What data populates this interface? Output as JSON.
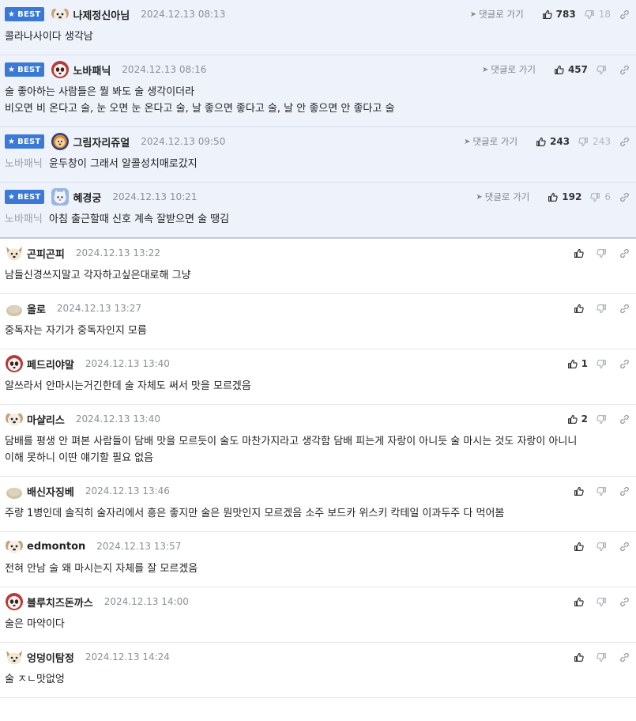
{
  "ui": {
    "best_label": "BEST",
    "goto_label": "댓글로 가기"
  },
  "colors": {
    "best_bg": "#eef3fb",
    "badge_bg": "#3b79d6",
    "date": "#8a8f98",
    "muted": "#9ca1a8"
  },
  "comments": [
    {
      "best": true,
      "avatar": "puppy-avatar",
      "nickname": "나제정신아님",
      "date": "2024.12.13 08:13",
      "likes": "783",
      "dislikes": "18",
      "reply_to": "",
      "lines": [
        "콜라나사이다 생각남"
      ]
    },
    {
      "best": true,
      "avatar": "panda-avatar",
      "nickname": "노바패닉",
      "date": "2024.12.13 08:16",
      "likes": "457",
      "dislikes": "",
      "reply_to": "",
      "lines": [
        "술 좋아하는 사람들은 뭘 봐도 술 생각이더라",
        "비오면 비 온다고 술, 눈 오면 눈 온다고 술, 날 좋으면 좋다고 술, 날 안 좋으면 안 좋다고 술"
      ]
    },
    {
      "best": true,
      "avatar": "lion-avatar",
      "nickname": "그림자리쥬얼",
      "date": "2024.12.13 09:50",
      "likes": "243",
      "dislikes": "243",
      "reply_to": "노바패닉",
      "lines": [
        "윤두창이 그래서 알콜성치매로갔지"
      ]
    },
    {
      "best": true,
      "avatar": "cat-avatar",
      "nickname": "혜경궁",
      "date": "2024.12.13 10:21",
      "likes": "192",
      "dislikes": "6",
      "reply_to": "노바패닉",
      "lines": [
        "아침 출근할때 신호 계속 잘받으면 술 땡김"
      ]
    },
    {
      "best": false,
      "avatar": "fox-avatar",
      "nickname": "곤피곤피",
      "date": "2024.12.13 13:22",
      "likes": "",
      "dislikes": "",
      "reply_to": "",
      "lines": [
        "남들신경쓰지말고 각자하고싶은대로해 그냥"
      ]
    },
    {
      "best": false,
      "avatar": "rock-avatar",
      "nickname": "올로",
      "date": "2024.12.13 13:27",
      "likes": "",
      "dislikes": "",
      "reply_to": "",
      "lines": [
        "중독자는 자기가 중독자인지 모름"
      ]
    },
    {
      "best": false,
      "avatar": "panda-avatar",
      "nickname": "페드리야말",
      "date": "2024.12.13 13:40",
      "likes": "1",
      "dislikes": "",
      "reply_to": "",
      "lines": [
        "알쓰라서 안마시는거긴한데 술 자체도 써서 맛을 모르겠음"
      ]
    },
    {
      "best": false,
      "avatar": "puppy-avatar",
      "nickname": "마샬리스",
      "date": "2024.12.13 13:40",
      "likes": "2",
      "dislikes": "",
      "reply_to": "",
      "lines": [
        "담배를 평생 안 펴본 사람들이 담배 맛을 모르듯이 술도 마찬가지라고 생각함 담배 피는게 자랑이 아니듯 술 마시는 것도 자랑이 아니니",
        "이해 못하니 이딴 얘기할 필요 없음"
      ]
    },
    {
      "best": false,
      "avatar": "rock-avatar",
      "nickname": "배신자징베",
      "date": "2024.12.13 13:46",
      "likes": "",
      "dislikes": "",
      "reply_to": "",
      "lines": [
        "주량 1병인데 솔직히 술자리에서 흥은 좋지만 술은 뭔맛인지 모르겠음 소주 보드카 위스키 칵테일 이과두주 다 먹어봄"
      ]
    },
    {
      "best": false,
      "avatar": "puppy-avatar",
      "nickname": "edmonton",
      "date": "2024.12.13 13:57",
      "likes": "",
      "dislikes": "",
      "reply_to": "",
      "lines": [
        "전혀 안남 술 왜 마시는지 자체를 잘 모르겠음"
      ]
    },
    {
      "best": false,
      "avatar": "panda-avatar",
      "nickname": "블루치즈돈까스",
      "date": "2024.12.13 14:00",
      "likes": "",
      "dislikes": "",
      "reply_to": "",
      "lines": [
        "술은 마약이다"
      ]
    },
    {
      "best": false,
      "avatar": "fox-avatar",
      "nickname": "엉덩이탐정",
      "date": "2024.12.13 14:24",
      "likes": "",
      "dislikes": "",
      "reply_to": "",
      "lines": [
        "술 ㅈㄴ맛없엉"
      ]
    }
  ]
}
